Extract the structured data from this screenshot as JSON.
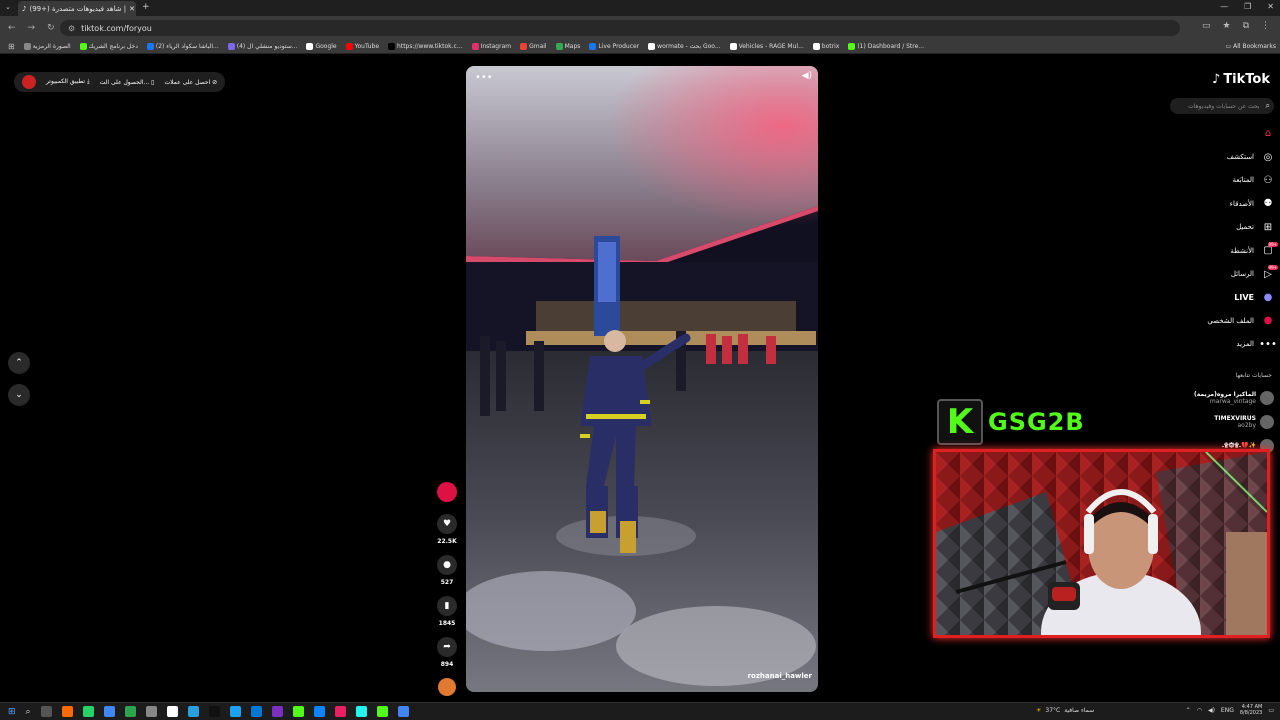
{
  "browser": {
    "tab_title": "(99+) شاهد فيديوهات متصدرة |",
    "url": "tiktok.com/foryou",
    "bookmarks": [
      {
        "label": "الصورة الرمزية",
        "color": "#888888"
      },
      {
        "label": "دخل برنامج الشريك",
        "color": "#53fc18"
      },
      {
        "label": "(2) الباشا سكواد الرياء...",
        "color": "#1877f2"
      },
      {
        "label": "(4) ستوديو منشلي ال...",
        "color": "#7b68ee"
      },
      {
        "label": "Google",
        "color": "#ffffff"
      },
      {
        "label": "YouTube",
        "color": "#ff0000"
      },
      {
        "label": "https://www.tiktok.c...",
        "color": "#000000"
      },
      {
        "label": "Instagram",
        "color": "#e1306c"
      },
      {
        "label": "Gmail",
        "color": "#ea4335"
      },
      {
        "label": "Maps",
        "color": "#34a853"
      },
      {
        "label": "Live Producer",
        "color": "#1877f2"
      },
      {
        "label": "wormate - بحث Goo...",
        "color": "#ffffff"
      },
      {
        "label": "Vehicles - RAGE Mul...",
        "color": "#ffffff"
      },
      {
        "label": "botrix",
        "color": "#ffffff"
      },
      {
        "label": "(1) Dashboard / Stre...",
        "color": "#53fc18"
      }
    ],
    "all_bookmarks": "All Bookmarks"
  },
  "top_buttons": {
    "app": "تطبيق الكمبيوتر",
    "get_on": "الحصول على الت...",
    "coins": "احصل على عملات"
  },
  "video": {
    "username": "rozhanai_hawler"
  },
  "actions": {
    "likes": "22.5K",
    "comments": "527",
    "saves": "1845",
    "shares": "894"
  },
  "sidebar": {
    "logo": "TikTok",
    "search_placeholder": "بحث عن حسابات وفيديوهات",
    "menu": [
      {
        "label": "",
        "icon": "home-icon",
        "glyph": "⌂",
        "badge": ""
      },
      {
        "label": "استكشف",
        "icon": "compass-icon",
        "glyph": "◎",
        "badge": ""
      },
      {
        "label": "المتابَعة",
        "icon": "following-icon",
        "glyph": "⚇",
        "badge": ""
      },
      {
        "label": "الأصدقاء",
        "icon": "friends-icon",
        "glyph": "⚉",
        "badge": ""
      },
      {
        "label": "تحميل",
        "icon": "upload-icon",
        "glyph": "⊞",
        "badge": ""
      },
      {
        "label": "الأنشطة",
        "icon": "activity-icon",
        "glyph": "▢",
        "badge": "99+"
      },
      {
        "label": "الرسائل",
        "icon": "messages-icon",
        "glyph": "▷",
        "badge": "99+"
      },
      {
        "label": "LIVE",
        "icon": "live-icon",
        "glyph": "●",
        "badge": ""
      },
      {
        "label": "الملف الشخصي",
        "icon": "profile-icon",
        "glyph": "●",
        "badge": ""
      },
      {
        "label": "المزيد",
        "icon": "more-icon",
        "glyph": "•••",
        "badge": ""
      }
    ],
    "following_header": "حسابات تتابعها",
    "following": [
      {
        "name": "الماكيرا مروه(مريمة)",
        "handle": "marwa_vintage"
      },
      {
        "name": "TIMEXVIRUS",
        "handle": "ao2by"
      },
      {
        "name": "ـ۩۞۩ـ💔✨",
        "handle": ""
      }
    ]
  },
  "stream": {
    "k_letter": "K",
    "name": "GSG2B"
  },
  "taskbar": {
    "weather_temp": "37°C",
    "weather_text": "سماء صافية",
    "lang": "ENG",
    "time": "4:47 AM",
    "date": "8/8/2023"
  }
}
